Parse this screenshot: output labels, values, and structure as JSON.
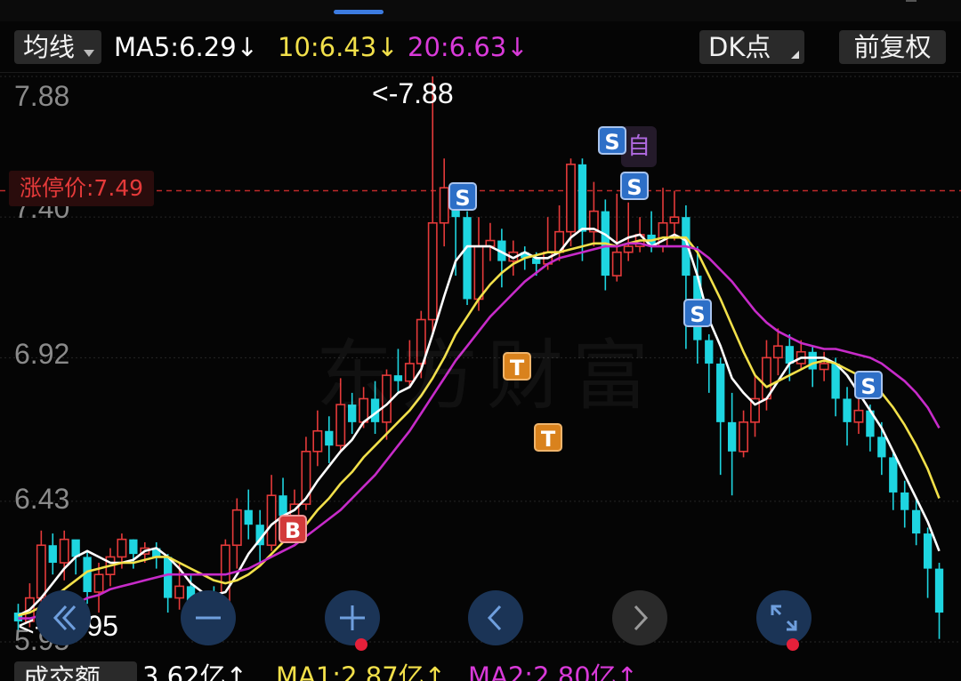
{
  "header": {
    "indicator_select": "均线",
    "ma5": "MA5:6.29",
    "ma5_arrow": "↓",
    "ma10": "10:6.43",
    "ma10_arrow": "↓",
    "ma20": "20:6.63",
    "ma20_arrow": "↓",
    "dk_select": "DK点",
    "adjust_button": "前复权"
  },
  "axis": {
    "ticks": [
      "7.88",
      "7.40",
      "6.92",
      "6.43",
      "5.95"
    ],
    "limit_up_label": "涨停价:7.49"
  },
  "annotations": {
    "high": "<-7.88",
    "low": "<---5.95"
  },
  "signals": {
    "s_label": "S",
    "t_label": "T",
    "b_label": "B",
    "self_label": "自"
  },
  "watermark": "东方财富",
  "footer": {
    "volume_select": "成交额",
    "volume": "3.62亿",
    "volume_arrow": "↑",
    "ma1": "MA1:2.87亿",
    "ma1_arrow": "↑",
    "ma2": "MA2:2.80亿",
    "ma2_arrow": "↑"
  },
  "colors": {
    "up": "#e53a3a",
    "down": "#1ed5e0",
    "ma5": "#ffffff",
    "ma10": "#f2e04a",
    "ma20": "#c72bc9",
    "ma5_text": "#ffffff",
    "ma10_text": "#f2e04a",
    "ma20_text": "#d93ad9"
  },
  "chart_data": {
    "type": "candlestick",
    "ylim": [
      5.95,
      7.88
    ],
    "y_ticks": [
      7.88,
      7.4,
      6.92,
      6.43,
      5.95
    ],
    "limit_up": 7.49,
    "high_marker": 7.88,
    "low_marker": 5.95,
    "candles": [
      [
        6.05,
        6.02,
        6.08,
        5.98
      ],
      [
        6.02,
        6.1,
        6.15,
        6.0
      ],
      [
        6.1,
        6.28,
        6.33,
        6.06
      ],
      [
        6.28,
        6.22,
        6.32,
        6.18
      ],
      [
        6.22,
        6.3,
        6.33,
        6.16
      ],
      [
        6.3,
        6.24,
        6.28,
        6.18
      ],
      [
        6.24,
        6.12,
        6.26,
        6.08
      ],
      [
        6.12,
        6.18,
        6.22,
        6.05
      ],
      [
        6.18,
        6.24,
        6.27,
        6.14
      ],
      [
        6.24,
        6.3,
        6.32,
        6.2
      ],
      [
        6.3,
        6.25,
        6.3,
        6.2
      ],
      [
        6.25,
        6.27,
        6.29,
        6.22
      ],
      [
        6.27,
        6.24,
        6.29,
        6.2
      ],
      [
        6.24,
        6.1,
        6.25,
        6.05
      ],
      [
        6.1,
        6.14,
        6.22,
        6.06
      ],
      [
        6.14,
        6.02,
        6.18,
        5.97
      ],
      [
        6.02,
        6.1,
        6.12,
        5.98
      ],
      [
        6.1,
        6.03,
        6.14,
        6.0
      ],
      [
        6.03,
        6.28,
        6.3,
        6.0
      ],
      [
        6.28,
        6.4,
        6.44,
        6.2
      ],
      [
        6.4,
        6.35,
        6.47,
        6.3
      ],
      [
        6.35,
        6.28,
        6.4,
        6.22
      ],
      [
        6.28,
        6.45,
        6.52,
        6.26
      ],
      [
        6.45,
        6.38,
        6.51,
        6.34
      ],
      [
        6.38,
        6.42,
        6.47,
        6.32
      ],
      [
        6.42,
        6.6,
        6.65,
        6.4
      ],
      [
        6.6,
        6.67,
        6.74,
        6.55
      ],
      [
        6.67,
        6.62,
        6.72,
        6.56
      ],
      [
        6.62,
        6.76,
        6.85,
        6.6
      ],
      [
        6.76,
        6.7,
        6.8,
        6.66
      ],
      [
        6.7,
        6.78,
        6.82,
        6.68
      ],
      [
        6.78,
        6.7,
        6.84,
        6.66
      ],
      [
        6.7,
        6.86,
        6.88,
        6.64
      ],
      [
        6.86,
        6.84,
        6.95,
        6.8
      ],
      [
        6.84,
        6.9,
        6.98,
        6.82
      ],
      [
        6.9,
        7.05,
        7.08,
        6.85
      ],
      [
        7.05,
        7.38,
        7.88,
        7.0
      ],
      [
        7.38,
        7.5,
        7.6,
        7.3
      ],
      [
        7.5,
        7.4,
        7.48,
        7.2
      ],
      [
        7.4,
        7.12,
        7.42,
        7.1
      ],
      [
        7.12,
        7.3,
        7.4,
        7.08
      ],
      [
        7.3,
        7.32,
        7.38,
        7.25
      ],
      [
        7.32,
        7.25,
        7.36,
        7.16
      ],
      [
        7.25,
        7.28,
        7.32,
        7.2
      ],
      [
        7.28,
        7.26,
        7.3,
        7.22
      ],
      [
        7.26,
        7.24,
        7.28,
        7.2
      ],
      [
        7.24,
        7.28,
        7.4,
        7.22
      ],
      [
        7.28,
        7.35,
        7.44,
        7.25
      ],
      [
        7.35,
        7.58,
        7.6,
        7.3
      ],
      [
        7.58,
        7.35,
        7.6,
        7.25
      ],
      [
        7.35,
        7.42,
        7.52,
        7.3
      ],
      [
        7.42,
        7.2,
        7.46,
        7.15
      ],
      [
        7.2,
        7.28,
        7.48,
        7.18
      ],
      [
        7.28,
        7.3,
        7.45,
        7.25
      ],
      [
        7.3,
        7.34,
        7.4,
        7.28
      ],
      [
        7.34,
        7.3,
        7.42,
        7.28
      ],
      [
        7.3,
        7.38,
        7.5,
        7.28
      ],
      [
        7.38,
        7.4,
        7.49,
        7.32
      ],
      [
        7.4,
        7.2,
        7.44,
        6.95
      ],
      [
        7.2,
        6.98,
        7.3,
        6.9
      ],
      [
        6.98,
        6.9,
        7.0,
        6.8
      ],
      [
        6.9,
        6.7,
        6.92,
        6.52
      ],
      [
        6.7,
        6.6,
        6.8,
        6.45
      ],
      [
        6.6,
        6.7,
        6.74,
        6.58
      ],
      [
        6.7,
        6.78,
        6.86,
        6.65
      ],
      [
        6.78,
        6.92,
        6.98,
        6.74
      ],
      [
        6.92,
        6.96,
        7.02,
        6.86
      ],
      [
        6.96,
        6.9,
        7.0,
        6.84
      ],
      [
        6.9,
        6.94,
        6.98,
        6.88
      ],
      [
        6.94,
        6.88,
        6.96,
        6.82
      ],
      [
        6.88,
        6.9,
        6.94,
        6.84
      ],
      [
        6.9,
        6.78,
        6.92,
        6.72
      ],
      [
        6.78,
        6.7,
        6.82,
        6.62
      ],
      [
        6.7,
        6.74,
        6.78,
        6.66
      ],
      [
        6.74,
        6.65,
        6.76,
        6.6
      ],
      [
        6.65,
        6.58,
        6.7,
        6.52
      ],
      [
        6.58,
        6.46,
        6.6,
        6.4
      ],
      [
        6.46,
        6.4,
        6.5,
        6.34
      ],
      [
        6.4,
        6.32,
        6.44,
        6.28
      ],
      [
        6.32,
        6.2,
        6.34,
        6.1
      ],
      [
        6.2,
        6.05,
        6.22,
        5.96
      ]
    ],
    "series": [
      {
        "name": "MA5",
        "values": [
          6.04,
          6.06,
          6.1,
          6.15,
          6.2,
          6.24,
          6.26,
          6.24,
          6.22,
          6.22,
          6.23,
          6.26,
          6.27,
          6.24,
          6.2,
          6.15,
          6.12,
          6.11,
          6.12,
          6.18,
          6.25,
          6.3,
          6.35,
          6.38,
          6.4,
          6.44,
          6.5,
          6.55,
          6.6,
          6.64,
          6.7,
          6.73,
          6.76,
          6.8,
          6.82,
          6.88,
          7.0,
          7.13,
          7.25,
          7.3,
          7.3,
          7.3,
          7.28,
          7.26,
          7.28,
          7.26,
          7.26,
          7.28,
          7.33,
          7.36,
          7.36,
          7.34,
          7.31,
          7.33,
          7.34,
          7.3,
          7.32,
          7.34,
          7.32,
          7.2,
          7.05,
          6.96,
          6.85,
          6.8,
          6.76,
          6.78,
          6.84,
          6.9,
          6.92,
          6.92,
          6.92,
          6.9,
          6.86,
          6.8,
          6.74,
          6.68,
          6.6,
          6.52,
          6.44,
          6.36,
          6.26
        ]
      },
      {
        "name": "MA10",
        "values": [
          6.04,
          6.05,
          6.07,
          6.1,
          6.13,
          6.16,
          6.19,
          6.2,
          6.21,
          6.22,
          6.22,
          6.23,
          6.24,
          6.24,
          6.22,
          6.2,
          6.18,
          6.16,
          6.15,
          6.16,
          6.18,
          6.21,
          6.25,
          6.29,
          6.32,
          6.35,
          6.4,
          6.44,
          6.49,
          6.53,
          6.58,
          6.62,
          6.66,
          6.7,
          6.74,
          6.79,
          6.85,
          6.92,
          7.0,
          7.06,
          7.12,
          7.17,
          7.21,
          7.24,
          7.26,
          7.27,
          7.28,
          7.28,
          7.29,
          7.3,
          7.31,
          7.31,
          7.3,
          7.31,
          7.32,
          7.32,
          7.33,
          7.33,
          7.33,
          7.28,
          7.2,
          7.12,
          7.03,
          6.94,
          6.86,
          6.82,
          6.84,
          6.86,
          6.88,
          6.9,
          6.91,
          6.9,
          6.88,
          6.86,
          6.84,
          6.8,
          6.75,
          6.69,
          6.62,
          6.54,
          6.44
        ]
      },
      {
        "name": "MA20",
        "values": [
          6.03,
          6.03,
          6.04,
          6.05,
          6.06,
          6.08,
          6.1,
          6.11,
          6.13,
          6.14,
          6.15,
          6.16,
          6.17,
          6.18,
          6.18,
          6.18,
          6.18,
          6.18,
          6.18,
          6.19,
          6.2,
          6.22,
          6.24,
          6.26,
          6.28,
          6.31,
          6.34,
          6.37,
          6.4,
          6.44,
          6.48,
          6.52,
          6.57,
          6.62,
          6.67,
          6.73,
          6.79,
          6.85,
          6.91,
          6.96,
          7.01,
          7.06,
          7.1,
          7.14,
          7.18,
          7.21,
          7.24,
          7.26,
          7.27,
          7.28,
          7.29,
          7.3,
          7.3,
          7.31,
          7.31,
          7.3,
          7.3,
          7.3,
          7.3,
          7.29,
          7.26,
          7.22,
          7.18,
          7.13,
          7.08,
          7.04,
          7.01,
          6.99,
          6.97,
          6.96,
          6.95,
          6.95,
          6.94,
          6.93,
          6.92,
          6.9,
          6.87,
          6.84,
          6.8,
          6.75,
          6.68
        ]
      }
    ]
  }
}
